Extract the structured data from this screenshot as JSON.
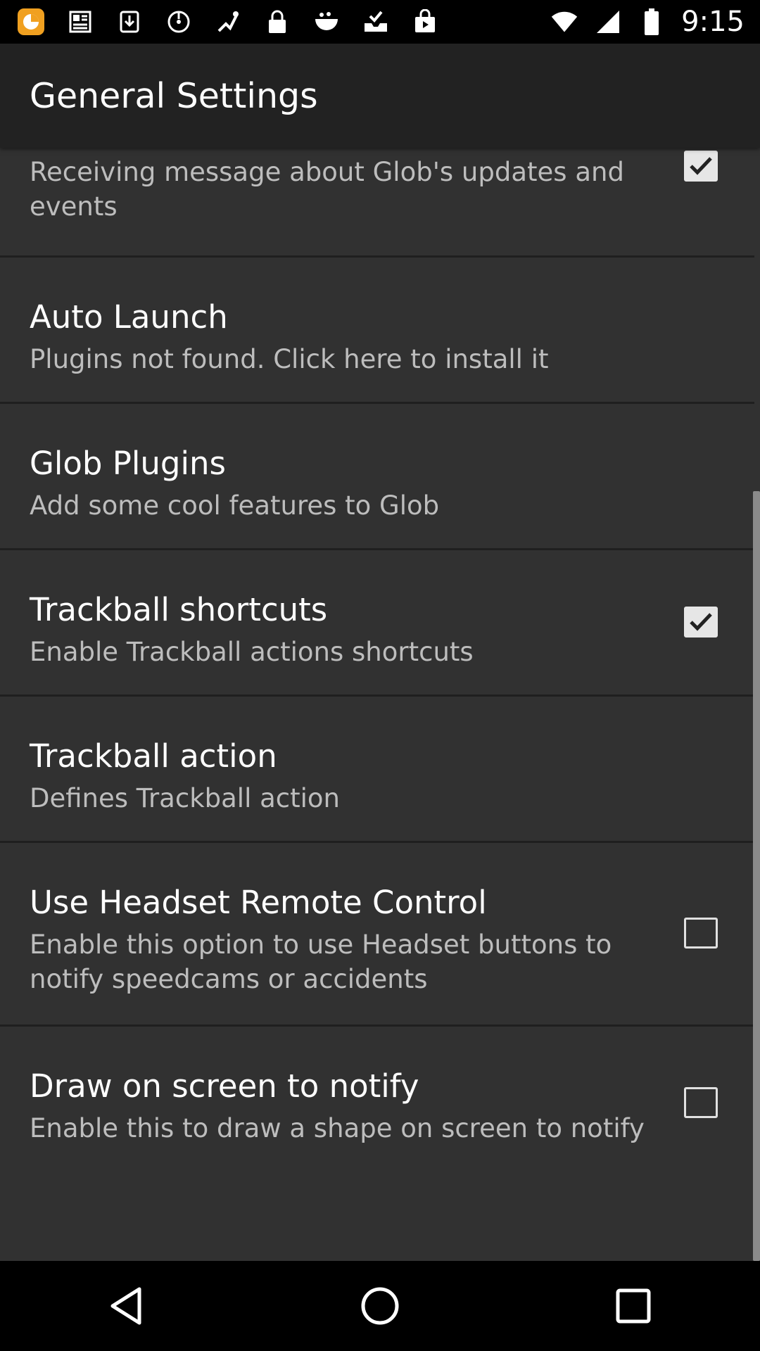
{
  "status_bar": {
    "time": "9:15",
    "icons_left": [
      "app-notification-icon",
      "news-icon",
      "download-icon",
      "settings-icon",
      "fake-gps-icon",
      "lock-icon",
      "bowl-icon",
      "tray-check-icon",
      "shopping-bag-icon"
    ],
    "icons_right": [
      "wifi-icon",
      "signal-icon",
      "battery-icon"
    ]
  },
  "app_bar": {
    "title": "General Settings"
  },
  "preferences": [
    {
      "title": "",
      "summary": "Receiving message about Glob's updates and events",
      "checkbox": "checked"
    },
    {
      "title": "Auto Launch",
      "summary": "Plugins not found. Click here to install it",
      "checkbox": "none"
    },
    {
      "title": "Glob Plugins",
      "summary": "Add some cool features to Glob",
      "checkbox": "none"
    },
    {
      "title": "Trackball shortcuts",
      "summary": "Enable Trackball actions shortcuts",
      "checkbox": "checked"
    },
    {
      "title": "Trackball action",
      "summary": "Defines Trackball action",
      "checkbox": "none"
    },
    {
      "title": "Use Headset Remote Control",
      "summary": "Enable this option to use Headset buttons to notify speedcams or accidents",
      "checkbox": "unchecked"
    },
    {
      "title": "Draw on screen to notify",
      "summary": "Enable this to draw a shape on screen to notify",
      "checkbox": "unchecked"
    }
  ],
  "nav_bar": {
    "buttons": [
      "back-icon",
      "home-icon",
      "recents-icon"
    ]
  },
  "colors": {
    "background": "#313131",
    "app_bar": "#222222",
    "summary_text": "#bdbdbd"
  }
}
